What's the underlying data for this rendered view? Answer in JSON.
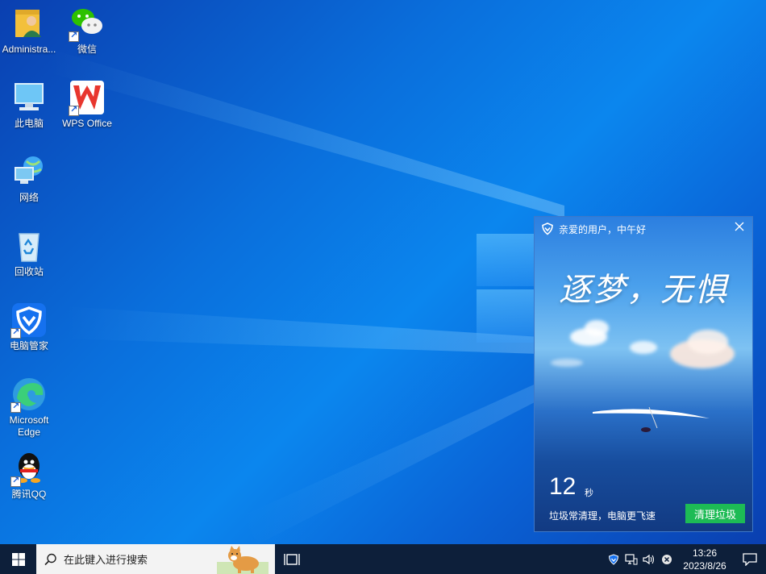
{
  "desktop": {
    "icons": [
      {
        "label": "Administra...",
        "icon": "user-folder-icon"
      },
      {
        "label": "微信",
        "icon": "wechat-icon"
      },
      {
        "label": "此电脑",
        "icon": "computer-icon"
      },
      {
        "label": "WPS Office",
        "icon": "wps-office-icon"
      },
      {
        "label": "网络",
        "icon": "network-icon"
      },
      {
        "label": "回收站",
        "icon": "recycle-bin-icon"
      },
      {
        "label": "电脑管家",
        "icon": "pc-manager-icon"
      },
      {
        "label": "Microsoft Edge",
        "icon": "edge-icon"
      },
      {
        "label": "腾讯QQ",
        "icon": "qq-icon"
      }
    ]
  },
  "popup": {
    "greeting": "亲爱的用户，中午好",
    "slogan": "逐梦，无惧",
    "countdown": "12",
    "countdown_unit": "秒",
    "tip": "垃圾常清理，电脑更飞速",
    "button": "清理垃圾"
  },
  "taskbar": {
    "search_placeholder": "在此键入进行搜索",
    "time": "13:26",
    "date": "2023/8/26"
  },
  "colors": {
    "desktop_accent": "#0a78e6",
    "taskbar_bg": "#0d1f3a",
    "clean_button": "#1dbb55"
  }
}
